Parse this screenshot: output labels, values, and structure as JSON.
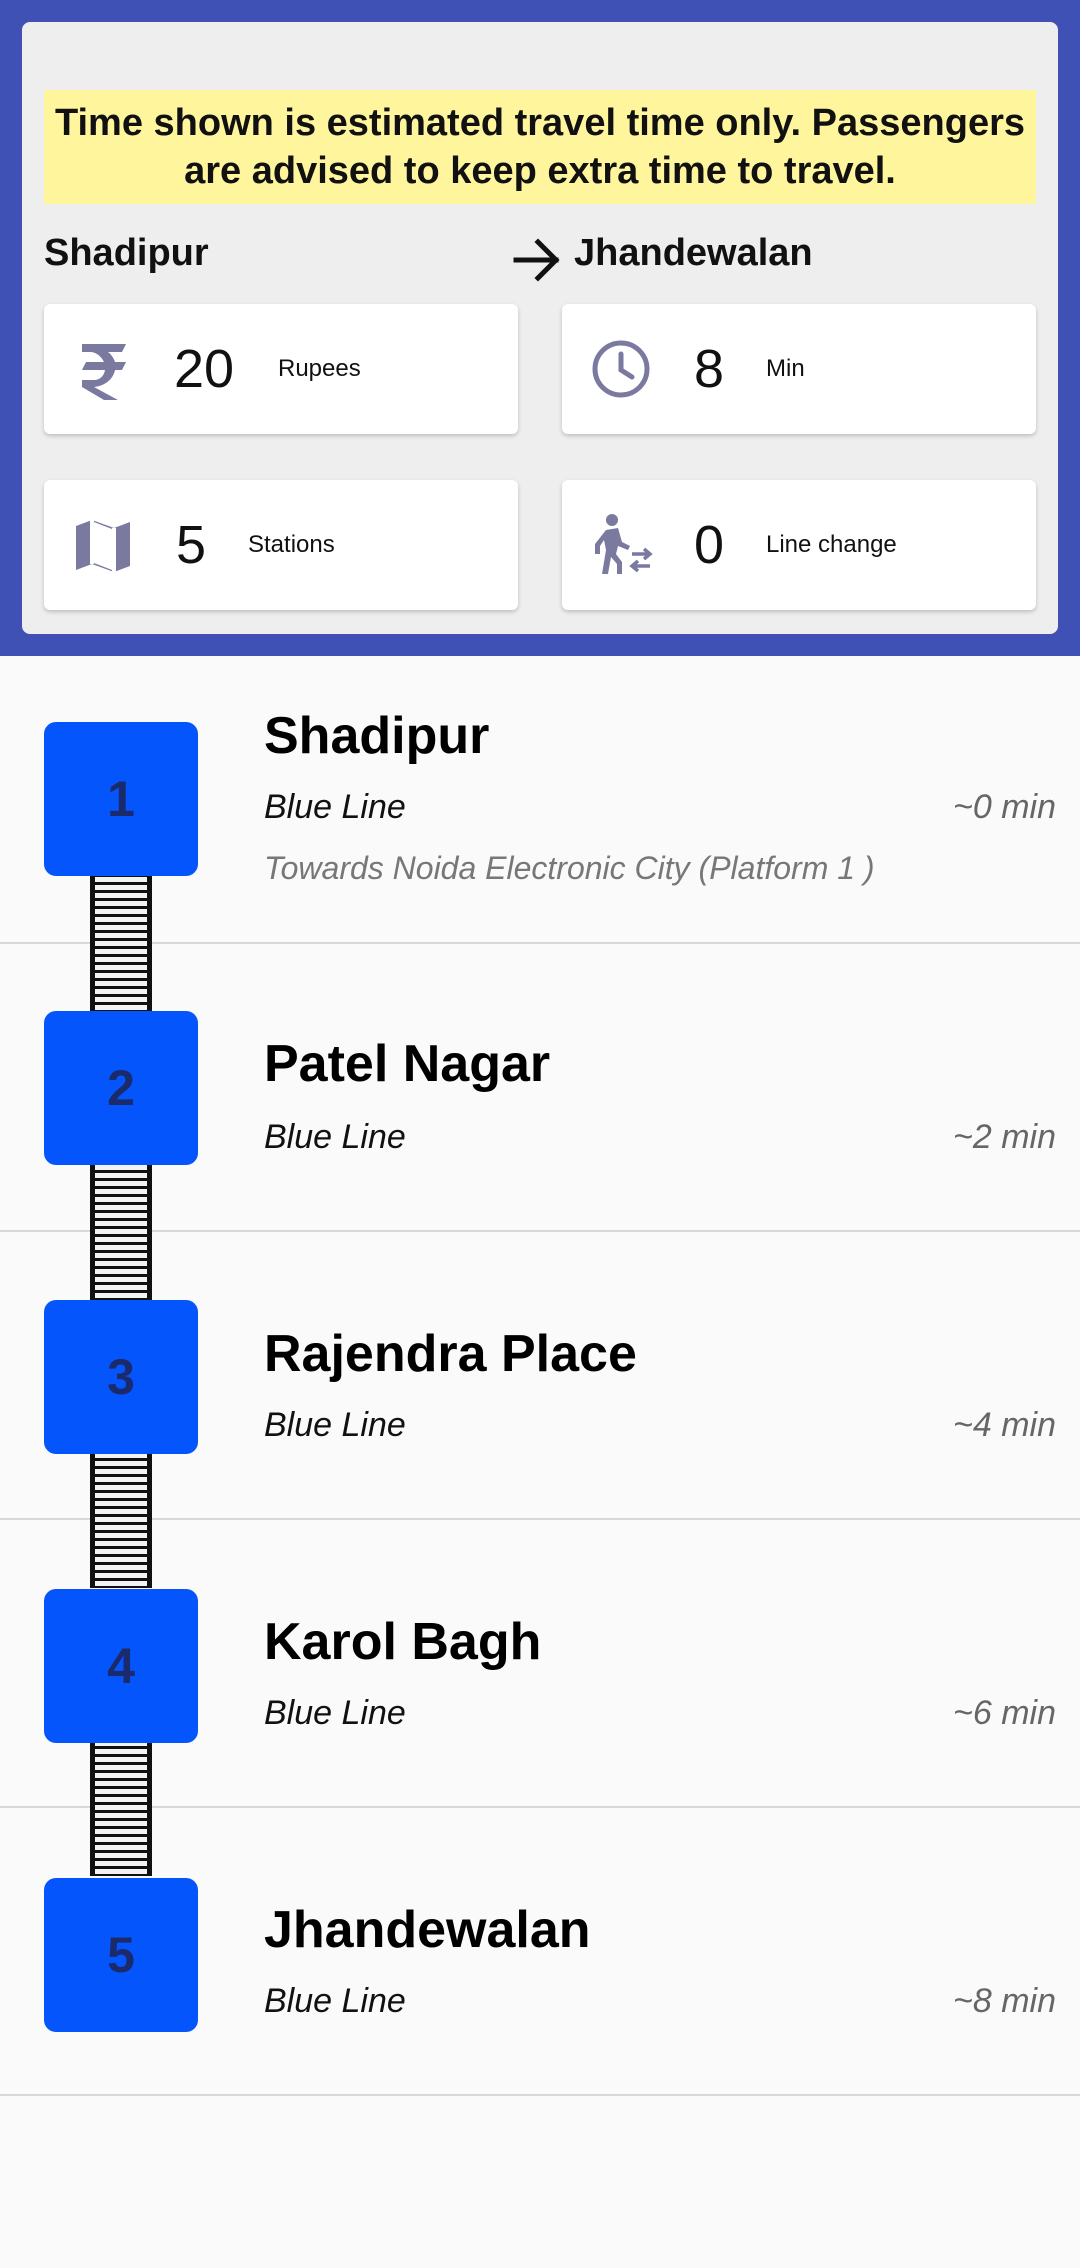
{
  "notice": "Time shown is estimated travel time only. Passengers are advised to keep extra time to travel.",
  "route": {
    "from": "Shadipur",
    "to": "Jhandewalan"
  },
  "stats": {
    "fare": {
      "value": "20",
      "label": "Rupees",
      "icon": "rupee-icon"
    },
    "time": {
      "value": "8",
      "label": "Min",
      "icon": "clock-icon"
    },
    "stations": {
      "value": "5",
      "label": "Stations",
      "icon": "map-icon"
    },
    "line_change": {
      "value": "0",
      "label": "Line change",
      "icon": "transfer-walk-icon"
    }
  },
  "stations": [
    {
      "number": "1",
      "name": "Shadipur",
      "line": "Blue Line",
      "time": "~0 min",
      "direction": "Towards Noida Electronic City (Platform 1 )"
    },
    {
      "number": "2",
      "name": "Patel Nagar",
      "line": "Blue Line",
      "time": "~2 min"
    },
    {
      "number": "3",
      "name": "Rajendra Place",
      "line": "Blue Line",
      "time": "~4 min"
    },
    {
      "number": "4",
      "name": "Karol Bagh",
      "line": "Blue Line",
      "time": "~6 min"
    },
    {
      "number": "5",
      "name": "Jhandewalan",
      "line": "Blue Line",
      "time": "~8 min"
    }
  ],
  "colors": {
    "header": "#3f51b5",
    "station_box": "#0455fb",
    "notice_bg": "#fff59d",
    "icon": "#7a7aa0"
  }
}
